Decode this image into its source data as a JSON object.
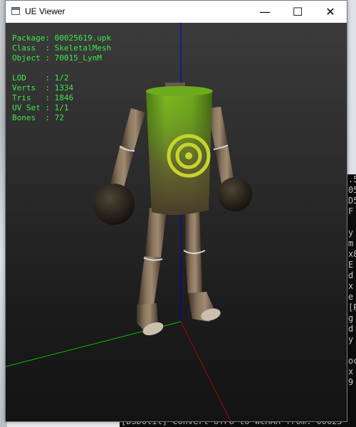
{
  "window": {
    "title": "UE Viewer",
    "controls": {
      "minimize": "—",
      "maximize": "☐",
      "close": "✕"
    }
  },
  "info": {
    "package": "Package: 00025619.upk",
    "class": "Class  : SkeletalMesh",
    "object": "Object : 70015_LynM",
    "lod": "LOD    : 1/2",
    "verts": "Verts  : 1334",
    "tris": "Tris   : 1846",
    "uvset": "UV Set : 1/1",
    "bones": "Bones  : 72"
  },
  "colors": {
    "info_text": "#3ee84a",
    "axis_x": "#b00000",
    "axis_y": "#00c000",
    "axis_z": "#0000d0"
  },
  "background": {
    "console_lines": [
      ".5",
      "05",
      "D5",
      "F",
      "",
      "y",
      "m",
      "x8",
      "E",
      "d",
      "x",
      "e",
      "[P",
      "g",
      "d",
      "y",
      "",
      "oc",
      "x",
      "9"
    ],
    "bottom_console": "[D3DUtil] Convert UTF8 to WCHAR from: 00025"
  }
}
